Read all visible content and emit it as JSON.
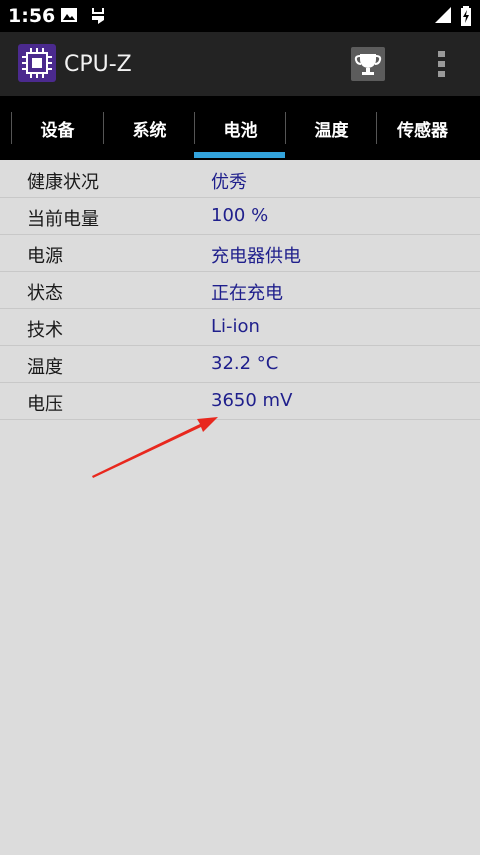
{
  "status_bar": {
    "time": "1:56",
    "icons": [
      "image-icon",
      "bug-icon",
      "signal-icon",
      "battery-charging-icon"
    ]
  },
  "app_bar": {
    "title": "CPU-Z",
    "logo_icon": "cpu-chip-icon",
    "actions": [
      "trophy-icon",
      "more-vert-icon"
    ]
  },
  "tabs": [
    {
      "label": "设备",
      "active": false
    },
    {
      "label": "系统",
      "active": false
    },
    {
      "label": "电池",
      "active": true
    },
    {
      "label": "温度",
      "active": false
    },
    {
      "label": "传感器",
      "active": false
    }
  ],
  "battery_info": [
    {
      "label": "健康状况",
      "value": "优秀"
    },
    {
      "label": "当前电量",
      "value": "100 %"
    },
    {
      "label": "电源",
      "value": "充电器供电"
    },
    {
      "label": "状态",
      "value": "正在充电"
    },
    {
      "label": "技术",
      "value": "Li-ion"
    },
    {
      "label": "温度",
      "value": "32.2 °C"
    },
    {
      "label": "电压",
      "value": "3650 mV"
    }
  ],
  "colors": {
    "accent": "#33a3dc",
    "value_text": "#1f1f8c",
    "annotation": "#e8281e",
    "logo_bg": "#4b2a8e"
  }
}
